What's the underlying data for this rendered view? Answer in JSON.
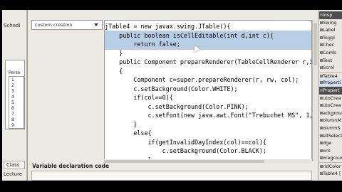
{
  "left_panel": {
    "sched_tab": "Schedi",
    "grid_header": "Perso",
    "row_numbers": [
      "1",
      "2",
      "3",
      "4",
      "5",
      "6",
      "7",
      "8",
      "9"
    ],
    "class_tab": "Class",
    "lecture_tab": "Lecture"
  },
  "dialog": {
    "combo_value": "custom creation",
    "declaration_label": "Variable declaration code"
  },
  "editor": {
    "lines": [
      {
        "text": "jTable4 = new javax.swing.JTable(){",
        "highlight": false
      },
      {
        "text": "    public boolean isCellEditable(int d,int c){",
        "highlight": true
      },
      {
        "text": "        return false;",
        "highlight": true
      },
      {
        "text": "    }",
        "highlight": false
      },
      {
        "text": "    public Component prepareRenderer(TableCellRenderer r,int",
        "highlight": false
      },
      {
        "text": "    {",
        "highlight": false
      },
      {
        "text": "        Component c=super.prepareRenderer(r, rw, col);",
        "highlight": false
      },
      {
        "text": "        c.setBackground(Color.WHITE);",
        "highlight": false
      },
      {
        "text": "        if(col==0){",
        "highlight": false
      },
      {
        "text": "            c.setBackground(Color.PINK);",
        "highlight": false
      },
      {
        "text": "            c.setFont(new java.awt.Font(\"Trebuchet MS\", 1, 12",
        "highlight": false
      },
      {
        "text": "        }",
        "highlight": false
      },
      {
        "text": "        else{",
        "highlight": false
      },
      {
        "text": "            if(getInvalidDayIndex(col)==col){",
        "highlight": false
      },
      {
        "text": "                c.setBackground(Color.BLACK);",
        "highlight": false
      },
      {
        "text": "            }",
        "highlight": false
      }
    ]
  },
  "right_panel": {
    "items": [
      {
        "label": "Insp",
        "style": "dark"
      },
      {
        "label": "Swing",
        "style": "normal"
      },
      {
        "label": "Label",
        "style": "normal"
      },
      {
        "label": "Toggl",
        "style": "normal"
      },
      {
        "label": "Chec",
        "style": "normal"
      },
      {
        "label": "Comb",
        "style": "normal"
      },
      {
        "label": "Text",
        "style": "normal"
      },
      {
        "label": "Scrol",
        "style": "normal"
      },
      {
        "label": "Table4",
        "style": "sep"
      },
      {
        "label": "Properti",
        "style": "sel"
      },
      {
        "label": "Propert",
        "style": "dark"
      },
      {
        "label": "utoCrea",
        "style": "normal"
      },
      {
        "label": "utoCrea",
        "style": "normal"
      },
      {
        "label": "ackgroun",
        "style": "normal"
      },
      {
        "label": "olumnM",
        "style": "normal"
      },
      {
        "label": "olumnS",
        "style": "normal"
      },
      {
        "label": "ellSelect",
        "style": "normal"
      },
      {
        "label": "dge",
        "style": "normal"
      },
      {
        "label": "ont",
        "style": "normal"
      },
      {
        "label": "oregroun",
        "style": "normal"
      },
      {
        "label": "ridColor",
        "style": "sep"
      },
      {
        "label": "Table4 [",
        "style": "normal"
      }
    ]
  },
  "colors": {
    "selection": "#b8cde6",
    "keyword": "#0000b0",
    "panel_bg": "#eceae4"
  }
}
